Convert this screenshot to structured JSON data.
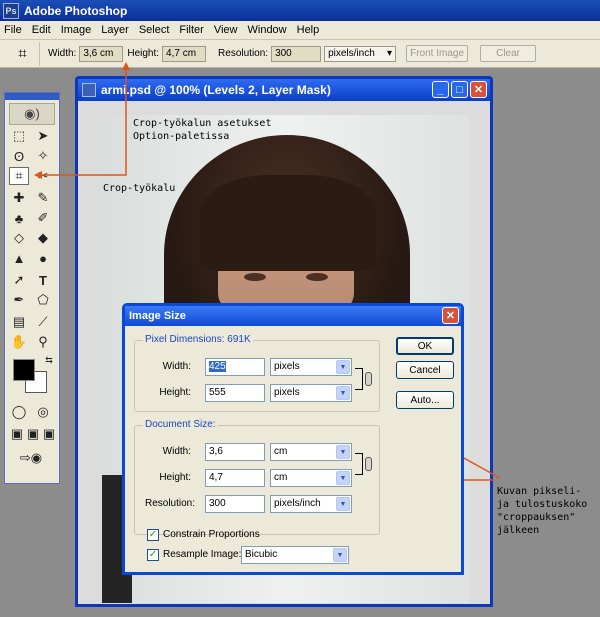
{
  "app": {
    "title": "Adobe Photoshop"
  },
  "menu": [
    "File",
    "Edit",
    "Image",
    "Layer",
    "Select",
    "Filter",
    "View",
    "Window",
    "Help"
  ],
  "options": {
    "width_label": "Width:",
    "width_value": "3,6 cm",
    "height_label": "Height:",
    "height_value": "4,7 cm",
    "resolution_label": "Resolution:",
    "resolution_value": "300",
    "resolution_unit": "pixels/inch",
    "front_image": "Front Image",
    "clear": "Clear"
  },
  "document": {
    "title": "armi.psd @ 100% (Levels 2, Layer Mask)"
  },
  "annotations": {
    "crop_options_line1": "Crop-työkalun asetukset",
    "crop_options_line2": "Option-paletissa",
    "crop_tool": "Crop-työkalu",
    "side_line1": "Kuvan pikseli-",
    "side_line2": "ja tulostuskoko",
    "side_line3": "\"croppauksen\"",
    "side_line4": "jälkeen",
    "arrow_color": "#e2541e"
  },
  "dialog": {
    "title": "Image Size",
    "pixel_dimensions_title": "Pixel Dimensions:",
    "pixel_dimensions_size": "691K",
    "px_width_label": "Width:",
    "px_width_value": "425",
    "px_width_unit": "pixels",
    "px_height_label": "Height:",
    "px_height_value": "555",
    "px_height_unit": "pixels",
    "document_size_title": "Document Size:",
    "doc_width_label": "Width:",
    "doc_width_value": "3,6",
    "doc_width_unit": "cm",
    "doc_height_label": "Height:",
    "doc_height_value": "4,7",
    "doc_height_unit": "cm",
    "resolution_label": "Resolution:",
    "resolution_value": "300",
    "resolution_unit": "pixels/inch",
    "constrain_label": "Constrain Proportions",
    "constrain_checked": true,
    "resample_label": "Resample Image:",
    "resample_checked": true,
    "resample_method": "Bicubic",
    "ok": "OK",
    "cancel": "Cancel",
    "auto": "Auto..."
  },
  "icons": {
    "crop": "crop-icon",
    "marquee": "marquee-icon",
    "move": "move-icon",
    "lasso": "lasso-icon",
    "magic_wand": "magic-wand-icon",
    "brush": "brush-icon",
    "stamp": "stamp-icon",
    "eraser": "eraser-icon",
    "bucket": "bucket-icon",
    "pen": "pen-icon",
    "type": "type-icon",
    "hand": "hand-icon",
    "zoom": "zoom-icon",
    "eyedropper": "eyedropper-icon"
  }
}
